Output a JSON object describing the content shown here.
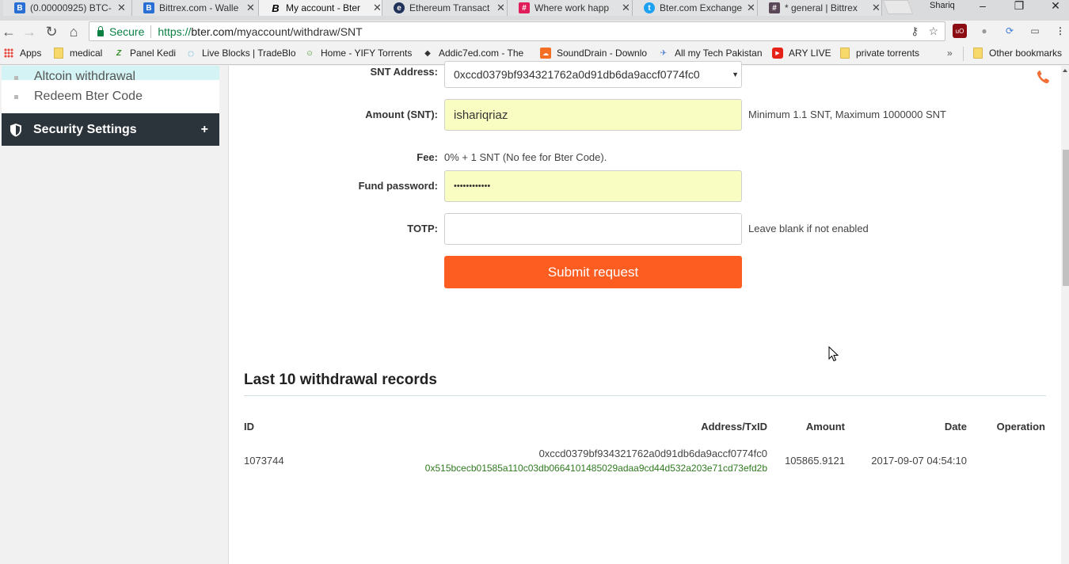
{
  "browser": {
    "tabs": [
      {
        "label": "(0.00000925) BTC-",
        "favicon": "bittrex-b-icon",
        "favicon_color": "#2a6fd4",
        "active": false
      },
      {
        "label": "Bittrex.com - Walle",
        "favicon": "bittrex-b-icon",
        "favicon_color": "#2a6fd4",
        "active": false
      },
      {
        "label": "My account - Bter",
        "favicon": "bter-b-icon",
        "favicon_color": "#000000",
        "active": true
      },
      {
        "label": "Ethereum Transact",
        "favicon": "etherscan-icon",
        "favicon_color": "#21325b",
        "active": false
      },
      {
        "label": "Where work happ",
        "favicon": "slack-icon",
        "favicon_color": "#e01e5a",
        "active": false
      },
      {
        "label": "Bter.com Exchange",
        "favicon": "twitter-icon",
        "favicon_color": "#1da1f2",
        "active": false
      },
      {
        "label": "* general | Bittrex",
        "favicon": "slack-hash-icon",
        "favicon_color": "#5a4758",
        "active": false
      }
    ],
    "profile_name": "Shariq",
    "window_controls": {
      "minimize": "–",
      "restore": "❐",
      "close": "✕"
    },
    "address_bar": {
      "security_label": "Secure",
      "url_scheme": "https://",
      "url_host": "bter.com",
      "url_path": "/myaccount/withdraw/SNT"
    },
    "bookmarks": [
      {
        "label": "Apps",
        "icon": "apps-grid-icon"
      },
      {
        "label": "medical",
        "icon": "folder-icon"
      },
      {
        "label": "Panel Kedi",
        "icon": "zp-icon"
      },
      {
        "label": "Live Blocks | TradeBlo",
        "icon": "tradeblock-icon"
      },
      {
        "label": "Home - YIFY Torrents",
        "icon": "yts-icon"
      },
      {
        "label": "Addic7ed.com - The",
        "icon": "addic7ed-icon"
      },
      {
        "label": "SoundDrain - Downlo",
        "icon": "soundcloud-icon"
      },
      {
        "label": "All my Tech Pakistan",
        "icon": "airplane-icon"
      },
      {
        "label": "ARY LIVE",
        "icon": "youtube-icon"
      },
      {
        "label": "private torrents",
        "icon": "folder-icon"
      }
    ],
    "bookmarks_overflow": "»",
    "other_bookmarks": "Other bookmarks"
  },
  "sidebar": {
    "items": [
      {
        "label": "Altcoin withdrawal",
        "active": true
      },
      {
        "label": "Redeem Bter Code",
        "active": false
      }
    ],
    "section": {
      "label": "Security Settings",
      "toggle": "+"
    }
  },
  "form": {
    "address": {
      "label": "SNT Address:",
      "value": "0xccd0379bf934321762a0d91db6da9accf0774fc0"
    },
    "amount": {
      "label": "Amount (SNT):",
      "value": "ishariqriaz",
      "hint": "Minimum 1.1 SNT, Maximum 1000000 SNT"
    },
    "fee": {
      "label": "Fee:",
      "value": "0% + 1 SNT (No fee for Bter Code)."
    },
    "fund_password": {
      "label": "Fund password:",
      "value": "••••••••••••"
    },
    "totp": {
      "label": "TOTP:",
      "value": "",
      "hint": "Leave blank if not enabled"
    },
    "submit_label": "Submit request"
  },
  "records": {
    "title": "Last 10 withdrawal records",
    "columns": [
      "ID",
      "Address/TxID",
      "Amount",
      "Date",
      "Operation"
    ],
    "rows": [
      {
        "id": "1073744",
        "address": "0xccd0379bf934321762a0d91db6da9accf0774fc0",
        "txid": "0x515bcecb01585a110c03db0664101485029adaa9cd44d532a203e71cd73efd2b",
        "amount": "105865.9121",
        "date": "2017-09-07 04:54:10",
        "operation": ""
      }
    ]
  },
  "colors": {
    "accent": "#fe5d22",
    "sidebar_section_bg": "#2c343b",
    "sidebar_active_bg": "#d4f3f4",
    "autofill_bg": "#fafdc2",
    "txid_green": "#2f7a1f"
  }
}
